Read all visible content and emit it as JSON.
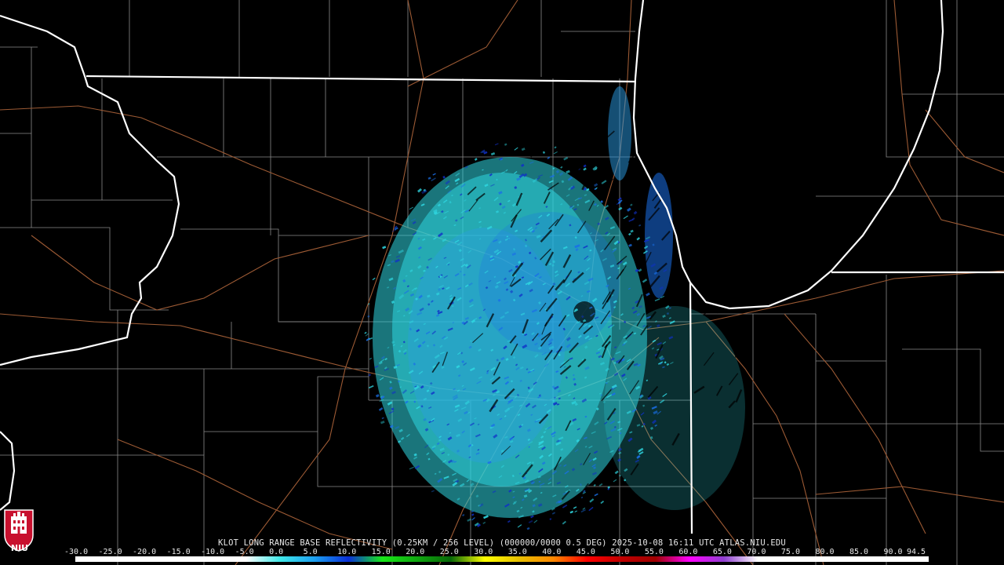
{
  "product": {
    "caption": "KLOT LONG RANGE BASE REFLECTIVITY (0.25KM / 256 LEVEL) (000000/0000 0.5 DEG) 2025-10-08 16:11 UTC  ATLAS.NIU.EDU",
    "logo_text": "NIU"
  },
  "colors": {
    "background": "#000000",
    "state_lines": "#ffffff",
    "county_lines": "#8a8a8a",
    "highways": "#9c5a34",
    "echo_light": "#2fd6e0",
    "echo_mid": "#1a6fe8",
    "echo_dark": "#1030c8"
  },
  "scale": {
    "labels": [
      "-30.0",
      "-25.0",
      "-20.0",
      "-15.0",
      "-10.0",
      "-5.0",
      "0.0",
      "5.0",
      "10.0",
      "15.0",
      "20.0",
      "25.0",
      "30.0",
      "35.0",
      "40.0",
      "45.0",
      "50.0",
      "55.0",
      "60.0",
      "65.0",
      "70.0",
      "75.0",
      "80.0",
      "85.0",
      "90.0",
      "94.5"
    ],
    "stops": [
      "#ffffff",
      "#ffffff",
      "#ffffff",
      "#ffffff",
      "#ffffff",
      "#ffffff",
      "#40e8e8",
      "#1ca0f0",
      "#0a30d8",
      "#18e818",
      "#10a810",
      "#086808",
      "#ffff00",
      "#e8c000",
      "#ff8800",
      "#ff0000",
      "#c00000",
      "#a00000",
      "#ff00ff",
      "#9040d0",
      "#ffffff",
      "#ffffff",
      "#ffffff",
      "#ffffff",
      "#ffffff",
      "#ffffff"
    ]
  }
}
